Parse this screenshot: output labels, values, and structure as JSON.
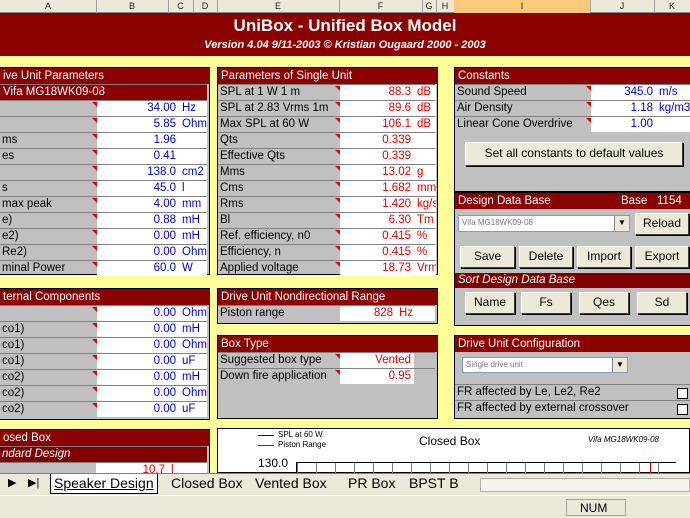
{
  "col_headers": [
    "A",
    "B",
    "C",
    "D",
    "E",
    "F",
    "G",
    "H",
    "I",
    "J",
    "K"
  ],
  "title": "UniBox   -   Unified Box Model",
  "subtitle": "Version 4.04  9/11-2003     ©  Kristian Ougaard  2000 - 2003",
  "drive_unit": {
    "header": "ive Unit Parameters",
    "driver": "Vifa MG18WK09-08",
    "rows": [
      {
        "label": "",
        "value": "34.00",
        "unit": "Hz"
      },
      {
        "label": "",
        "value": "5.85",
        "unit": "Ohm"
      },
      {
        "label": "ms",
        "value": "1.96",
        "unit": ""
      },
      {
        "label": "es",
        "value": "0.41",
        "unit": ""
      },
      {
        "label": "",
        "value": "138.0",
        "unit": "cm2"
      },
      {
        "label": "s",
        "value": "45.0",
        "unit": "l"
      },
      {
        "label": "max peak",
        "value": "4.00",
        "unit": "mm"
      },
      {
        "label": "e)",
        "value": "0.88",
        "unit": "mH"
      },
      {
        "label": "e2)",
        "value": "0.00",
        "unit": "mH"
      },
      {
        "label": "Re2)",
        "value": "0.00",
        "unit": "Ohm"
      },
      {
        "label": "minal Power",
        "value": "60.0",
        "unit": "W"
      }
    ]
  },
  "external": {
    "header": "ternal Components",
    "rows": [
      {
        "label": "",
        "value": "0.00",
        "unit": "Ohm"
      },
      {
        "label": "co1)",
        "value": "0.00",
        "unit": "mH"
      },
      {
        "label": "co1)",
        "value": "0.00",
        "unit": "Ohm"
      },
      {
        "label": "co1)",
        "value": "0.00",
        "unit": "uF"
      },
      {
        "label": "co2)",
        "value": "0.00",
        "unit": "mH"
      },
      {
        "label": "co2)",
        "value": "0.00",
        "unit": "Ohm"
      },
      {
        "label": "co2)",
        "value": "0.00",
        "unit": "uF"
      }
    ]
  },
  "closed_box": {
    "header": "osed Box",
    "sub": "ndard Design",
    "value": "10.7",
    "unit": "l"
  },
  "single_unit": {
    "header": "Parameters of Single Unit",
    "rows": [
      {
        "label": "SPL at 1 W 1 m",
        "value": "88.3",
        "unit": "dB"
      },
      {
        "label": "SPL at 2.83 Vrms 1m",
        "value": "89.6",
        "unit": "dB"
      },
      {
        "label": "Max SPL at 60 W",
        "value": "106.1",
        "unit": "dB"
      },
      {
        "label": "Qts",
        "value": "0.339",
        "unit": ""
      },
      {
        "label": "Effective Qts",
        "value": "0.339",
        "unit": ""
      },
      {
        "label": "Mms",
        "value": "13.02",
        "unit": "g"
      },
      {
        "label": "Cms",
        "value": "1.682",
        "unit": "mm/N"
      },
      {
        "label": "Rms",
        "value": "1.420",
        "unit": "kg/s"
      },
      {
        "label": "Bl",
        "value": "6.30",
        "unit": "Tm"
      },
      {
        "label": "Ref. efficiency, n0",
        "value": "0.415",
        "unit": "%"
      },
      {
        "label": "Efficiency, n",
        "value": "0.415",
        "unit": "%"
      },
      {
        "label": "Applied voltage",
        "value": "18.73",
        "unit": "Vrms"
      }
    ]
  },
  "nondirectional": {
    "header": "Drive Unit Nondirectional Range",
    "label": "Piston range",
    "value": "828",
    "unit": "Hz"
  },
  "box_type": {
    "header": "Box Type",
    "rows": [
      {
        "label": "Suggested box type",
        "value": "Vented"
      },
      {
        "label": "Down fire application",
        "value": "0.95"
      }
    ]
  },
  "constants": {
    "header": "Constants",
    "rows": [
      {
        "label": "Sound Speed",
        "value": "345.0",
        "unit": "m/s"
      },
      {
        "label": "Air Density",
        "value": "1.18",
        "unit": "kg/m3"
      },
      {
        "label": "Linear Cone Overdrive",
        "value": "1.00",
        "unit": ""
      }
    ],
    "button": "Set all constants to default values"
  },
  "design_db": {
    "header": "Design Data Base",
    "base_label": "Base",
    "base_count": "1154",
    "selected": "Vifa MG18WK09-08",
    "reload": "Reload",
    "save": "Save",
    "delete": "Delete",
    "import": "Import",
    "export": "Export",
    "sort_header": "Sort Design Data Base",
    "sort_name": "Name",
    "sort_fs": "Fs",
    "sort_qes": "Qes",
    "sort_sd": "Sd"
  },
  "config": {
    "header": "Drive Unit Configuration",
    "selected": "Single drive unit",
    "opt1": "FR affected by Le, Le2, Re2",
    "opt2": "FR affected by external crossover"
  },
  "chart": {
    "title": "Closed Box",
    "legend1": "SPL at 60 W",
    "legend2": "Piston Range",
    "driver": "Vifa MG18WK09-08",
    "ytick": "130.0"
  },
  "tabs": [
    "Speaker Design",
    "Closed Box",
    "Vented Box",
    "PR Box",
    "BPST B"
  ],
  "status": "NUM",
  "colors": {
    "header": "#8b0000",
    "sheet": "#ffff99",
    "panel": "#c0c0c0",
    "blue": "#0000cc",
    "red": "#e00000"
  }
}
